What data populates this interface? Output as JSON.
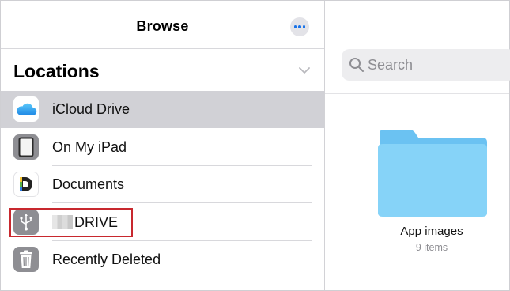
{
  "sidebar": {
    "title": "Browse",
    "section_title": "Locations",
    "items": [
      {
        "label": "iCloud Drive",
        "icon": "icloud-icon",
        "selected": true
      },
      {
        "label": "On My iPad",
        "icon": "ipad-icon",
        "selected": false
      },
      {
        "label": "Documents",
        "icon": "documents-app-icon",
        "selected": false
      },
      {
        "label": "DRIVE",
        "icon": "usb-icon",
        "selected": false
      },
      {
        "label": "Recently Deleted",
        "icon": "trash-icon",
        "selected": false
      }
    ]
  },
  "search": {
    "placeholder": "Search"
  },
  "folder": {
    "name": "App images",
    "count": "9 items"
  },
  "colors": {
    "selected_row": "#d1d1d6",
    "folder_blue": "#7fcff7",
    "accent": "#1a73e8",
    "highlight": "#c8282e"
  }
}
